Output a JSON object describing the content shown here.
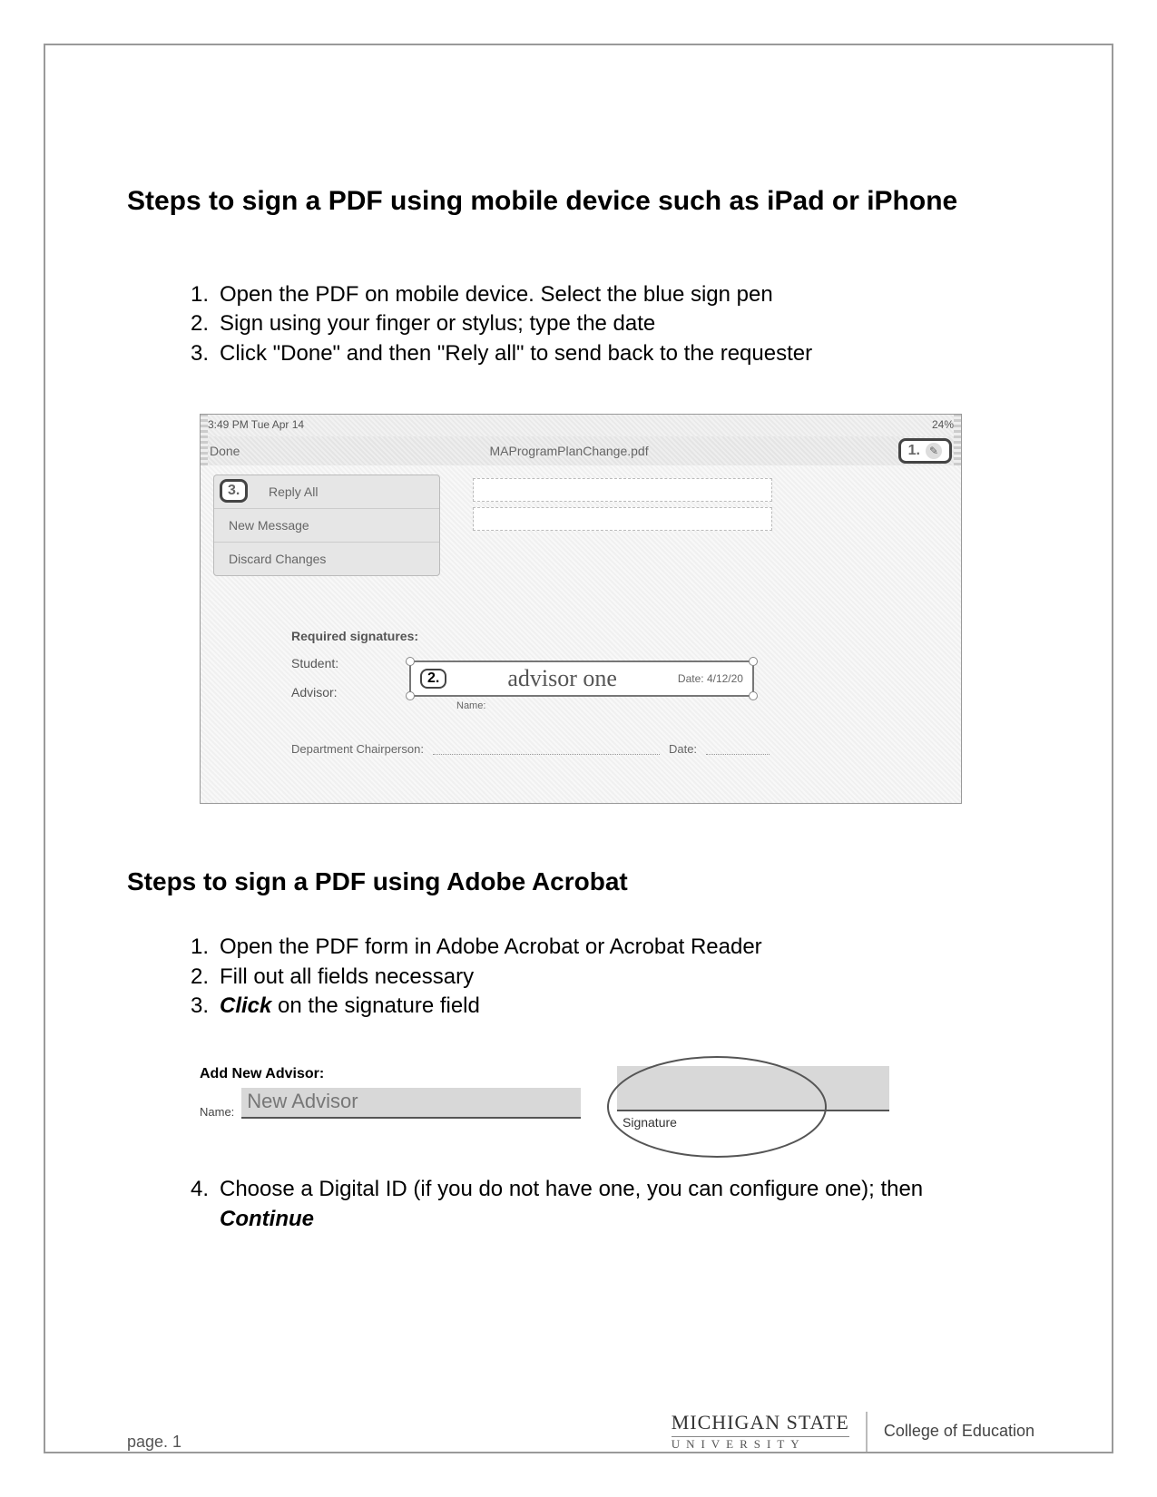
{
  "section1": {
    "title": "Steps to sign a PDF using mobile device such as iPad or iPhone",
    "steps": [
      "Open the PDF on mobile device.  Select the blue sign pen",
      "Sign using your finger or stylus; type the date",
      "Click \"Done\" and then \"Rely all\" to send back to the requester"
    ]
  },
  "mobile": {
    "time": "3:49 PM  Tue Apr 14",
    "battery": "24%",
    "done_label": "Done",
    "doc_title": "MAProgramPlanChange.pdf",
    "callout1": "1.",
    "menu": {
      "callout3": "3.",
      "items": [
        "Reply All",
        "New Message",
        "Discard Changes"
      ]
    },
    "req_label": "Required signatures:",
    "student_label": "Student:",
    "advisor_label": "Advisor:",
    "sig": {
      "callout2": "2.",
      "text": "advisor one",
      "date_prefix": "Date:",
      "date": "4/12/20",
      "name_label": "Name:"
    },
    "dept_label": "Department Chairperson:",
    "dept_date_label": "Date:"
  },
  "section2": {
    "title": "Steps to sign a PDF using Adobe Acrobat",
    "steps": [
      {
        "text": "Open the PDF form in Adobe Acrobat or Acrobat Reader"
      },
      {
        "text": "Fill out all fields necessary"
      },
      {
        "text_before": "",
        "bold": "Click",
        "text_after": " on the signature field"
      },
      {
        "text_before": "Choose a Digital ID (if you do not have one, you can configure one); then ",
        "bold": "Continue",
        "text_after": ""
      }
    ]
  },
  "acrobat": {
    "add_label": "Add New Advisor:",
    "name_label": "Name:",
    "name_value": "New Advisor",
    "sig_caption": "Signature"
  },
  "footer": {
    "page": "page. 1",
    "msu_top": "MICHIGAN STATE",
    "msu_bot": "UNIVERSITY",
    "college": "College of Education"
  }
}
